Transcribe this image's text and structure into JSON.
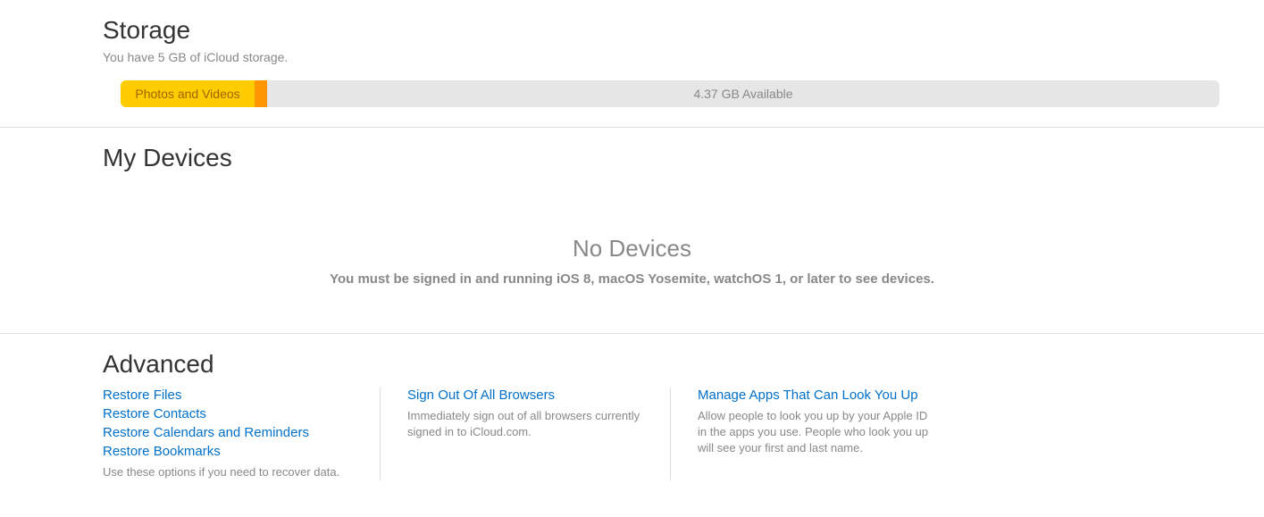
{
  "storage": {
    "title": "Storage",
    "subtitle": "You have 5 GB of iCloud storage.",
    "segments": {
      "photos_label": "Photos and Videos",
      "available_label": "4.37 GB Available"
    }
  },
  "devices": {
    "title": "My Devices",
    "empty_title": "No Devices",
    "empty_message": "You must be signed in and running iOS 8, macOS Yosemite, watchOS 1, or later to see devices."
  },
  "advanced": {
    "title": "Advanced",
    "col1": {
      "restore_files": "Restore Files",
      "restore_contacts": "Restore Contacts",
      "restore_calendars": "Restore Calendars and Reminders",
      "restore_bookmarks": "Restore Bookmarks",
      "desc": "Use these options if you need to recover data."
    },
    "col2": {
      "signout_link": "Sign Out Of All Browsers",
      "signout_desc": "Immediately sign out of all browsers currently signed in to iCloud.com."
    },
    "col3": {
      "manage_link": "Manage Apps That Can Look You Up",
      "manage_desc": "Allow people to look you up by your Apple ID in the apps you use. People who look you up will see your first and last name."
    }
  }
}
